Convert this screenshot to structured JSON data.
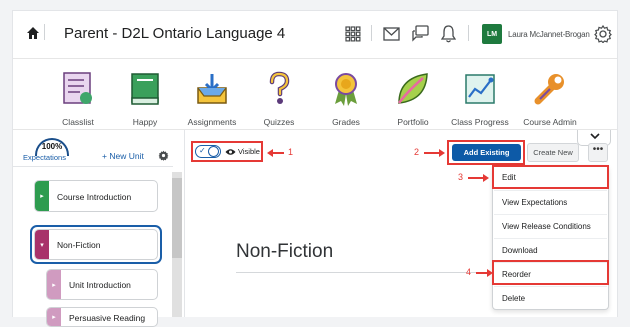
{
  "header": {
    "course_title": "Parent - D2L Ontario Language 4",
    "user_initials": "LM",
    "user_name": "Laura McJannet-Brogan"
  },
  "navbar": {
    "items": [
      {
        "label": "Classlist",
        "icon": "classlist-icon"
      },
      {
        "label": "Happy",
        "icon": "book-icon"
      },
      {
        "label": "Assignments",
        "icon": "inbox-tray-icon"
      },
      {
        "label": "Quizzes",
        "icon": "question-mark-icon"
      },
      {
        "label": "Grades",
        "icon": "ribbon-award-icon"
      },
      {
        "label": "Portfolio",
        "icon": "leaf-icon"
      },
      {
        "label": "Class Progress",
        "icon": "progress-chart-icon"
      },
      {
        "label": "Course Admin",
        "icon": "wrench-icon"
      }
    ]
  },
  "sidebar": {
    "expectations_pct": "100%",
    "expectations_label": "Expectations",
    "new_unit_label": "+ New Unit",
    "units": [
      {
        "label": "Course Introduction",
        "color": "#2e9c4f"
      },
      {
        "label": "Non-Fiction",
        "color": "#a8336a"
      },
      {
        "label": "Unit Introduction",
        "color": "#d09bc0"
      },
      {
        "label": "Persuasive Reading",
        "color": "#d09bc0"
      }
    ]
  },
  "toolbar": {
    "visible_label": "Visible",
    "add_existing": "Add Existing",
    "create_new": "Create New",
    "more": "•••"
  },
  "main": {
    "page_title": "Non-Fiction"
  },
  "menu": {
    "items": [
      "Edit",
      "View Expectations",
      "View Release Conditions",
      "Download",
      "Reorder",
      "Delete"
    ]
  },
  "annotations": {
    "one": "1",
    "two": "2",
    "three": "3",
    "four": "4"
  },
  "colors": {
    "accent": "#0d5aa7",
    "annotation": "#e53935",
    "avatar": "#1e7a3e"
  }
}
